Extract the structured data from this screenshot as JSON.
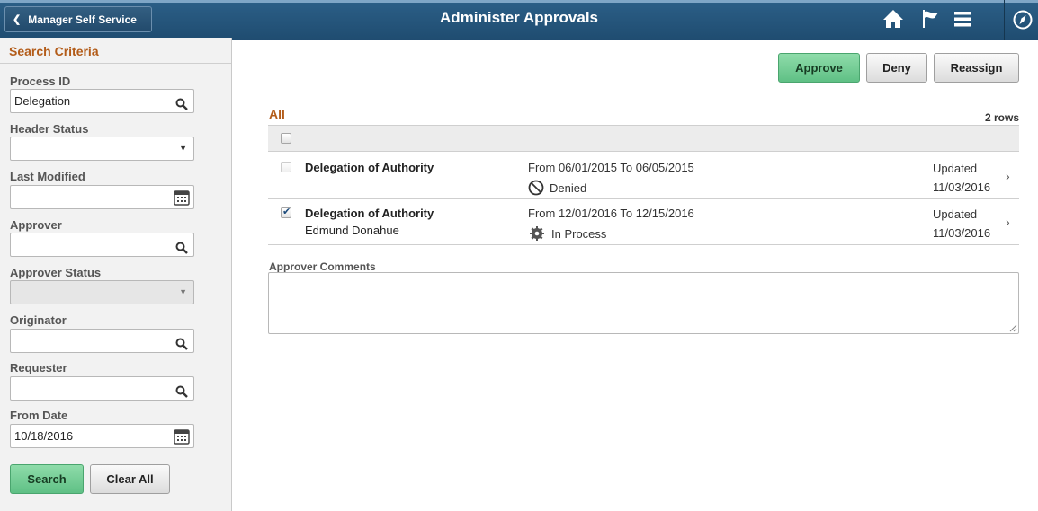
{
  "header": {
    "back_label": "Manager Self Service",
    "title": "Administer Approvals",
    "icons": [
      "home-icon",
      "flag-icon",
      "menu-icon",
      "navbar-icon"
    ],
    "color": "#1f4c70"
  },
  "search": {
    "title": "Search Criteria",
    "fields": [
      {
        "label": "Process ID",
        "value": "Delegation",
        "icon": "search-icon"
      },
      {
        "label": "Header Status",
        "value": "",
        "icon": "dropdown"
      },
      {
        "label": "Last Modified",
        "value": "",
        "icon": "calendar-icon"
      },
      {
        "label": "Approver",
        "value": "",
        "icon": "search-icon"
      },
      {
        "label": "Approver Status",
        "value": "",
        "icon": "dropdown",
        "disabled": true
      },
      {
        "label": "Originator",
        "value": "",
        "icon": "search-icon"
      },
      {
        "label": "Requester",
        "value": "",
        "icon": "search-icon"
      },
      {
        "label": "From Date",
        "value": "10/18/2016",
        "icon": "calendar-icon"
      }
    ],
    "search_button": "Search",
    "clear_button": "Clear All"
  },
  "actions": {
    "approve": "Approve",
    "deny": "Deny",
    "reassign": "Reassign"
  },
  "grid": {
    "title": "All",
    "row_count": "2 rows",
    "rows": [
      {
        "title": "Delegation of Authority",
        "subtitle": "",
        "range": "From 06/01/2015 To 06/05/2015",
        "status": "Denied",
        "status_icon": "denied-icon",
        "updated_label": "Updated",
        "updated_date": "11/03/2016",
        "checked": false,
        "checkbox_disabled": true
      },
      {
        "title": "Delegation of Authority",
        "subtitle": "Edmund Donahue",
        "range": "From 12/01/2016 To 12/15/2016",
        "status": "In Process",
        "status_icon": "in-process-icon",
        "updated_label": "Updated",
        "updated_date": "11/03/2016",
        "checked": true,
        "checkbox_disabled": false
      }
    ]
  },
  "comments": {
    "label": "Approver Comments",
    "value": ""
  },
  "colors": {
    "accent_orange": "#b35c19",
    "approve_green": "#6fcb90"
  }
}
